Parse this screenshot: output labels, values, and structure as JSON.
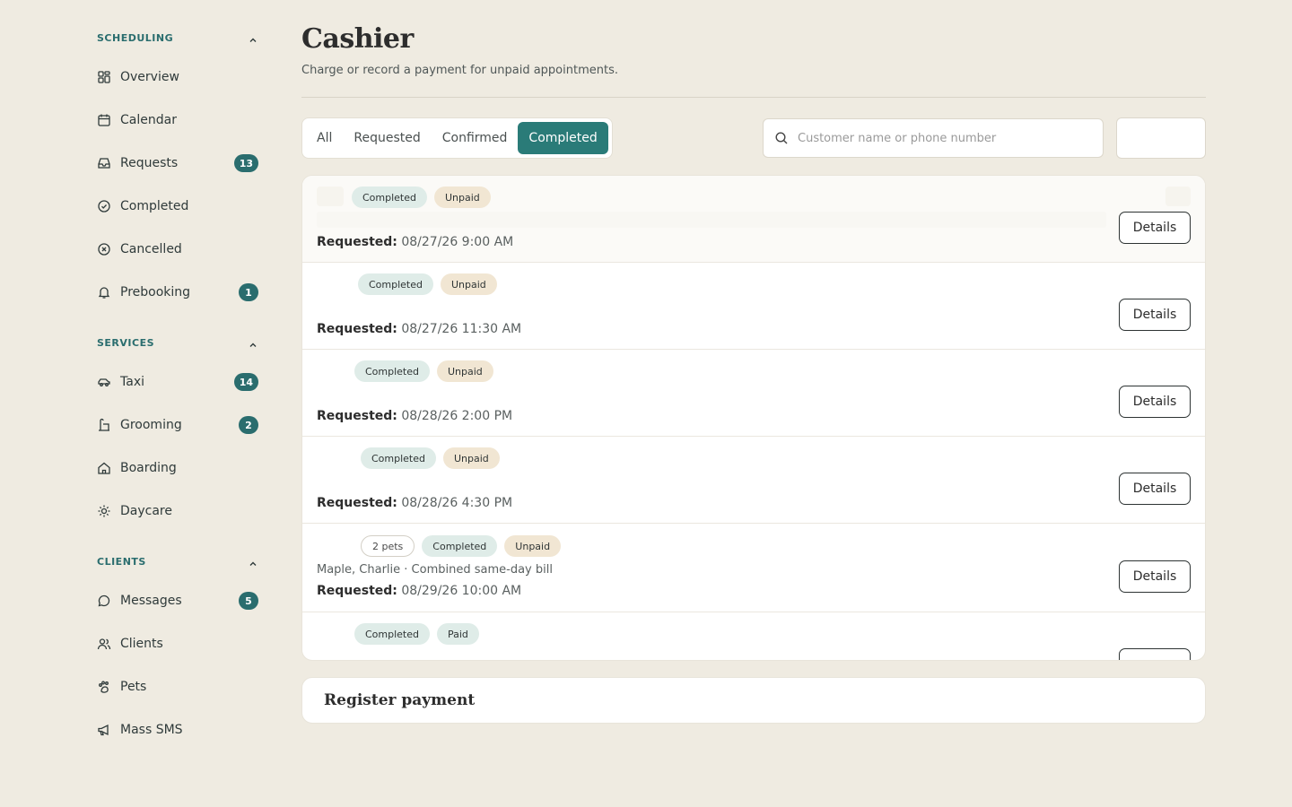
{
  "sidebar": {
    "sections": [
      {
        "title": "SCHEDULING",
        "items": [
          {
            "label": "Overview",
            "icon": "grid-icon",
            "badge": ""
          },
          {
            "label": "Calendar",
            "icon": "calendar-icon",
            "badge": ""
          },
          {
            "label": "Requests",
            "icon": "inbox-icon",
            "badge": "13"
          },
          {
            "label": "Completed",
            "icon": "check-circle-icon",
            "badge": ""
          },
          {
            "label": "Cancelled",
            "icon": "x-circle-icon",
            "badge": ""
          },
          {
            "label": "Prebooking",
            "icon": "bell-icon",
            "badge": "1"
          }
        ]
      },
      {
        "title": "SERVICES",
        "items": [
          {
            "label": "Taxi",
            "icon": "car-icon",
            "badge": "14"
          },
          {
            "label": "Grooming",
            "icon": "bath-icon",
            "badge": "2"
          },
          {
            "label": "Boarding",
            "icon": "home-icon",
            "badge": ""
          },
          {
            "label": "Daycare",
            "icon": "sun-icon",
            "badge": ""
          }
        ]
      },
      {
        "title": "CLIENTS",
        "items": [
          {
            "label": "Messages",
            "icon": "chat-icon",
            "badge": "5"
          },
          {
            "label": "Clients",
            "icon": "users-icon",
            "badge": ""
          },
          {
            "label": "Pets",
            "icon": "paw-icon",
            "badge": ""
          },
          {
            "label": "Mass SMS",
            "icon": "megaphone-icon",
            "badge": ""
          }
        ]
      }
    ]
  },
  "header": {
    "title": "Cashier",
    "subtitle": "Charge or record a payment for unpaid appointments."
  },
  "tabs": [
    "All",
    "Requested",
    "Confirmed",
    "Completed"
  ],
  "active_tab": "Completed",
  "search": {
    "placeholder": "Customer name or phone number",
    "value": ""
  },
  "rows": [
    {
      "pets": "",
      "status": "Completed",
      "payment": "Unpaid",
      "subline": "",
      "requested_label": "Requested:",
      "requested_at": "08/27/26 9:00 AM",
      "action": "Details"
    },
    {
      "pets": "",
      "status": "Completed",
      "payment": "Unpaid",
      "subline": "",
      "requested_label": "Requested:",
      "requested_at": "08/27/26 11:30 AM",
      "action": "Details"
    },
    {
      "pets": "",
      "status": "Completed",
      "payment": "Unpaid",
      "subline": "",
      "requested_label": "Requested:",
      "requested_at": "08/28/26 2:00 PM",
      "action": "Details"
    },
    {
      "pets": "",
      "status": "Completed",
      "payment": "Unpaid",
      "subline": "",
      "requested_label": "Requested:",
      "requested_at": "08/28/26 4:30 PM",
      "action": "Details"
    },
    {
      "pets": "2 pets",
      "status": "Completed",
      "payment": "Unpaid",
      "subline": "Maple, Charlie · Combined same-day bill",
      "requested_label": "Requested:",
      "requested_at": "08/29/26 10:00 AM",
      "action": "Details"
    },
    {
      "pets": "",
      "status": "Completed",
      "payment": "Paid",
      "subline": "",
      "requested_label": "",
      "requested_at": "",
      "action": ""
    }
  ],
  "register": {
    "title": "Register payment"
  },
  "colors": {
    "accent": "#2a7b78",
    "background": "#efebe1",
    "badge": "#2a6d6e"
  }
}
